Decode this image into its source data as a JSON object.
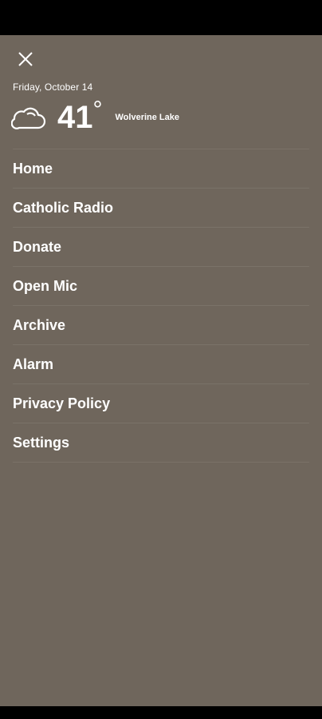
{
  "weather": {
    "date": "Friday, October 14",
    "icon": "cloud-icon",
    "temperature": "41",
    "degree_symbol": "°",
    "location": "Wolverine Lake"
  },
  "menu": {
    "items": [
      {
        "label": "Home"
      },
      {
        "label": "Catholic Radio"
      },
      {
        "label": "Donate"
      },
      {
        "label": "Open Mic"
      },
      {
        "label": "Archive"
      },
      {
        "label": "Alarm"
      },
      {
        "label": "Privacy Policy"
      },
      {
        "label": "Settings"
      }
    ]
  },
  "colors": {
    "drawer_background": "#6f665c",
    "text": "#ffffff",
    "system_bars": "#000000"
  }
}
